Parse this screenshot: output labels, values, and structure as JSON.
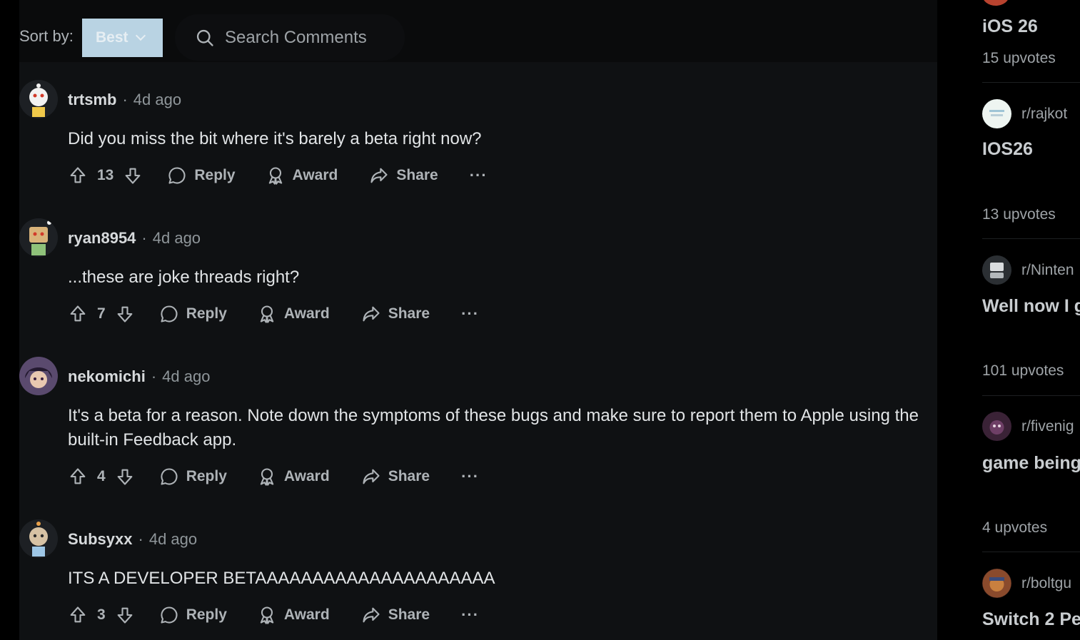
{
  "sort": {
    "label": "Sort by:",
    "value": "Best"
  },
  "search": {
    "placeholder": "Search Comments"
  },
  "comments": [
    {
      "user": "trtsmb",
      "time": "4d ago",
      "text": "Did you miss the bit where it's barely a beta right now?",
      "score": "13",
      "reply": "Reply",
      "award": "Award",
      "share": "Share"
    },
    {
      "user": "ryan8954",
      "time": "4d ago",
      "text": "...these are joke threads right?",
      "score": "7",
      "reply": "Reply",
      "award": "Award",
      "share": "Share"
    },
    {
      "user": "nekomichi",
      "time": "4d ago",
      "text": "It's a beta for a reason. Note down the symptoms of these bugs and make sure to report them to Apple using the built-in Feedback app.",
      "score": "4",
      "reply": "Reply",
      "award": "Award",
      "share": "Share"
    },
    {
      "user": "Subsyxx",
      "time": "4d ago",
      "text": "ITS A DEVELOPER BETAAAAAAAAAAAAAAAAAAAAA",
      "score": "3",
      "reply": "Reply",
      "award": "Award",
      "share": "Share"
    }
  ],
  "sidebar": {
    "posts": [
      {
        "title": "iOS 26",
        "upvotes": "15 upvotes"
      },
      {
        "subreddit": "r/rajkot",
        "title": "IOS26",
        "upvotes": "13 upvotes"
      },
      {
        "subreddit": "r/Ninten",
        "title": "Well now I g",
        "upvotes": "101 upvotes"
      },
      {
        "subreddit": "r/fivenig",
        "title": "game being",
        "upvotes": "4 upvotes"
      },
      {
        "subreddit": "r/boltgu",
        "title": "Switch 2 Pe"
      }
    ]
  },
  "colors": {
    "sort_bg": "#b9d3e3",
    "panel_bg": "#0f1113",
    "page_bg": "#000000",
    "text": "#d7dadc"
  }
}
